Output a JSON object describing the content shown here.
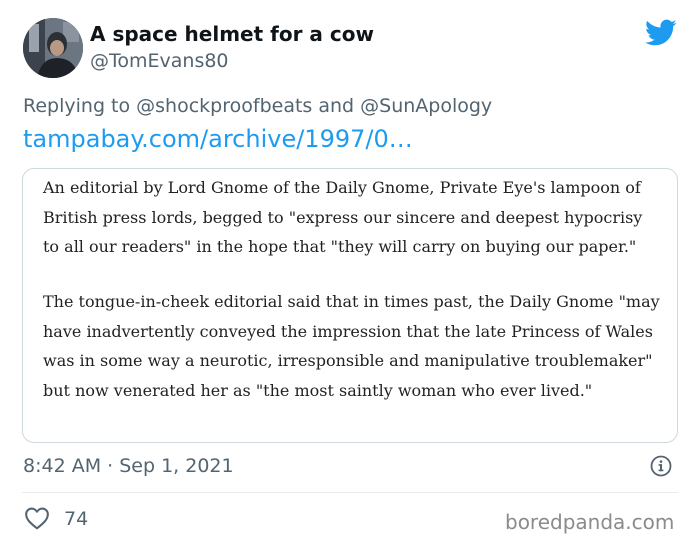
{
  "tweet": {
    "display_name": "A space helmet for a cow",
    "handle": "@TomEvans80",
    "reply_prefix": "Replying to ",
    "reply_mention_1": "@shockproofbeats",
    "reply_and": " and ",
    "reply_mention_2": "@SunApology",
    "link_text": "tampabay.com/archive/1997/0…",
    "timestamp": "8:42 AM · Sep 1, 2021",
    "like_count": "74"
  },
  "quote": {
    "paragraph_1": "An editorial by Lord Gnome of the Daily Gnome, Private Eye's lampoon of British press lords, begged to \"express our sincere and deepest hypocrisy to all our readers\" in the hope that \"they will carry on buying our paper.\"",
    "paragraph_2": "The tongue-in-cheek editorial said that in times past, the Daily Gnome \"may have inadvertently conveyed the impression that the late Princess of Wales was in some way a neurotic, irresponsible and manipulative troublemaker\" but now venerated her as \"the most saintly woman who ever lived.\""
  },
  "watermark": "boredpanda.com",
  "icons": {
    "brand": "twitter-bird-icon",
    "info": "info-icon",
    "like": "heart-icon"
  },
  "colors": {
    "twitter_blue": "#1d9bf0",
    "secondary_text": "#536471",
    "border": "#cfd9de"
  }
}
